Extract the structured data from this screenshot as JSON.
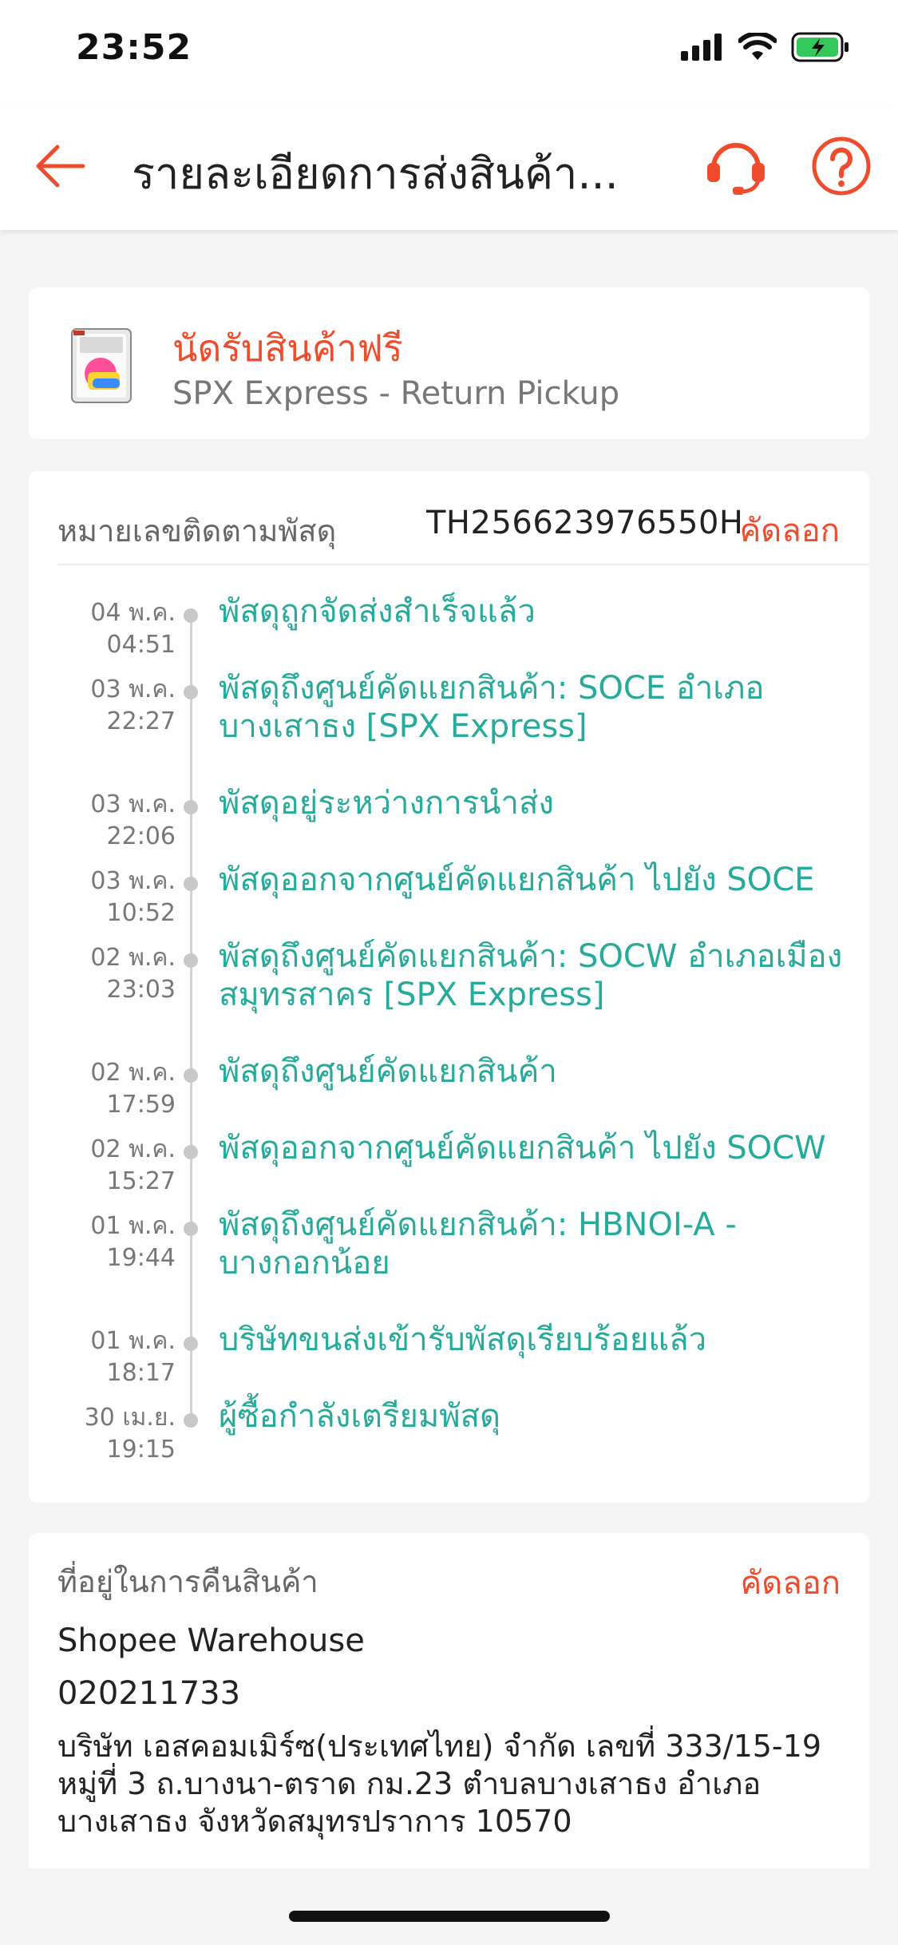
{
  "status_bar": {
    "time": "23:52",
    "icons": [
      "signal-icon",
      "wifi-icon",
      "battery-charging-icon"
    ]
  },
  "header": {
    "title": "รายละเอียดการส่งสินค้า...",
    "icons": [
      "back-arrow-icon",
      "customer-support-icon",
      "help-icon"
    ],
    "accent_color": "#ee4d2d"
  },
  "shipment": {
    "label": "นัดรับสินค้าฟรี",
    "carrier": "SPX Express - Return Pickup"
  },
  "tracking": {
    "label": "หมายเลขติดตามพัสดุ",
    "number": "TH256623976550H",
    "copy_label": "คัดลอก"
  },
  "events": [
    {
      "date": "04 พ.ค.",
      "time": "04:51",
      "text": "พัสดุถูกจัดส่งสำเร็จแล้ว"
    },
    {
      "date": "03 พ.ค.",
      "time": "22:27",
      "text": "พัสดุถึงศูนย์คัดแยกสินค้า: SOCE อำเภอบางเสาธง [SPX Express]"
    },
    {
      "date": "03 พ.ค.",
      "time": "22:06",
      "text": "พัสดุอยู่ระหว่างการนำส่ง"
    },
    {
      "date": "03 พ.ค.",
      "time": "10:52",
      "text": "พัสดุออกจากศูนย์คัดแยกสินค้า ไปยัง SOCE"
    },
    {
      "date": "02 พ.ค.",
      "time": "23:03",
      "text": "พัสดุถึงศูนย์คัดแยกสินค้า: SOCW อำเภอเมืองสมุทรสาคร [SPX Express]"
    },
    {
      "date": "02 พ.ค.",
      "time": "17:59",
      "text": "พัสดุถึงศูนย์คัดแยกสินค้า"
    },
    {
      "date": "02 พ.ค.",
      "time": "15:27",
      "text": "พัสดุออกจากศูนย์คัดแยกสินค้า ไปยัง SOCW"
    },
    {
      "date": "01 พ.ค.",
      "time": "19:44",
      "text": "พัสดุถึงศูนย์คัดแยกสินค้า: HBNOI-A - บางกอกน้อย"
    },
    {
      "date": "01 พ.ค.",
      "time": "18:17",
      "text": "บริษัทขนส่งเข้ารับพัสดุเรียบร้อยแล้ว"
    },
    {
      "date": "30 เม.ย.",
      "time": "19:15",
      "text": "ผู้ซื้อกำลังเตรียมพัสดุ"
    }
  ],
  "return_address": {
    "label": "ที่อยู่ในการคืนสินค้า",
    "copy_label": "คัดลอก",
    "name": "Shopee Warehouse",
    "phone": "020211733",
    "address": "บริษัท เอสคอมเมิร์ซ(ประเทศไทย) จำกัด เลขที่ 333/15-19 หมู่ที่ 3 ถ.บางนา-ตราด กม.23 ตำบลบางเสาธง อำเภอบางเสาธง จังหวัดสมุทรปราการ 10570"
  }
}
